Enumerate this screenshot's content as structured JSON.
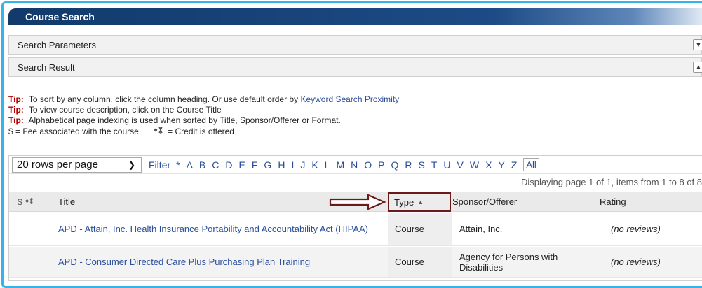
{
  "panel": {
    "title": "Course Search"
  },
  "sections": {
    "search_parameters": "Search Parameters",
    "search_result": "Search Result"
  },
  "tips": {
    "label": "Tip:",
    "t1_text": "To sort by any column, click the column heading. Or use default order by",
    "t1_link": "Keyword Search Proximity",
    "t2_text": "To view course description, click on the Course Title",
    "t3_text": "Alphabetical page indexing is used when sorted by Title, Sponsor/Offerer or Format.",
    "legend_fee_symbol": "$",
    "legend_fee": "= Fee associated with the course",
    "legend_credit": "= Credit is offered"
  },
  "pager": {
    "rows_per_page": "20 rows per page",
    "filter_label": "Filter",
    "letters": [
      "*",
      "A",
      "B",
      "C",
      "D",
      "E",
      "F",
      "G",
      "H",
      "I",
      "J",
      "K",
      "L",
      "M",
      "N",
      "O",
      "P",
      "Q",
      "R",
      "S",
      "T",
      "U",
      "V",
      "W",
      "X",
      "Y",
      "Z"
    ],
    "all_label": "All",
    "display_info": "Displaying page 1 of 1, items from 1 to 8 of 8"
  },
  "table": {
    "headers": {
      "fee_symbol": "$",
      "title": "Title",
      "type": "Type",
      "sponsor": "Sponsor/Offerer",
      "rating": "Rating"
    },
    "rows": [
      {
        "title": "APD - Attain, Inc. Health Insurance Portability and Accountability Act (HIPAA)",
        "type": "Course",
        "sponsor": "Attain, Inc.",
        "rating": "(no reviews)"
      },
      {
        "title": "APD - Consumer Directed Care Plus Purchasing Plan Training",
        "type": "Course",
        "sponsor": "Agency for Persons with Disabilities",
        "rating": "(no reviews)"
      }
    ]
  },
  "colors": {
    "frame_border": "#35b4ea",
    "title_bar": "#1c4b85",
    "link": "#2a4e9b",
    "tip_label": "#b00000",
    "annotation": "#6b1a1a"
  }
}
